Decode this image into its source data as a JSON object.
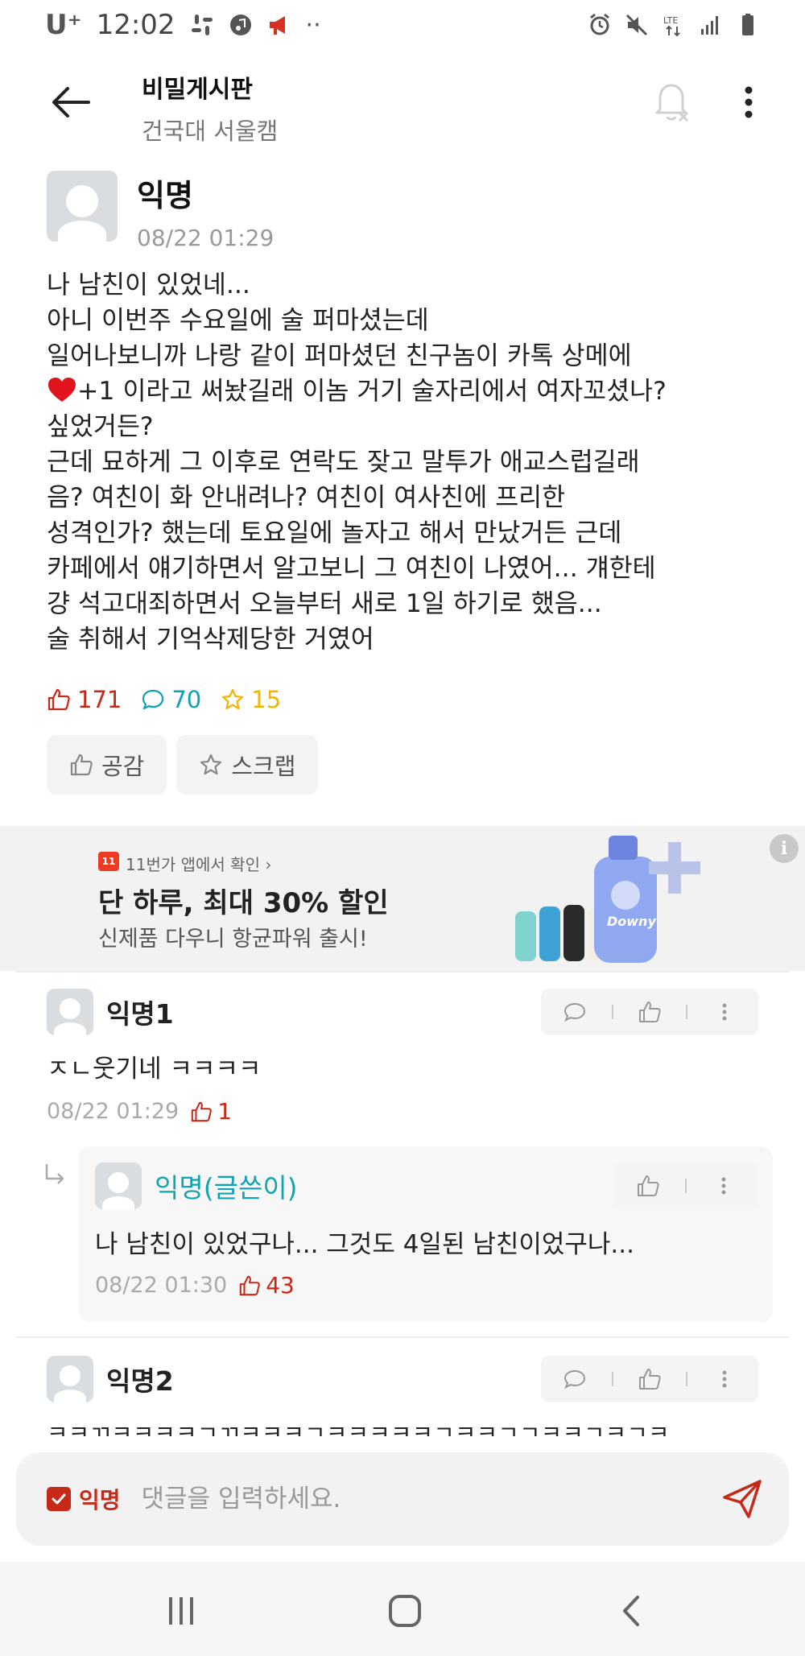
{
  "status_bar": {
    "carrier": "U⁺",
    "time": "12:02"
  },
  "header": {
    "board_title": "비밀게시판",
    "campus": "건국대 서울캠",
    "icons": [
      "back-arrow-icon",
      "notification-off-icon",
      "more-vert-icon"
    ]
  },
  "post": {
    "author": "익명",
    "date": "08/22 01:29",
    "lines": [
      "나 남친이 있었네...",
      "아니 이번주 수요일에 술 퍼마셨는데",
      "일어나보니까 나랑 같이 퍼마셨던 친구놈이 카톡 상메에",
      "+1 이라고 써놨길래 이놈 거기 술자리에서 여자꼬셨나?",
      "싶었거든?",
      "근데 묘하게 그 이후로 연락도 잦고 말투가 애교스럽길래",
      "음? 여친이 화 안내려나? 여친이 여사친에 프리한",
      "성격인가? 했는데 토요일에 놀자고 해서 만났거든 근데",
      "카페에서 얘기하면서 알고보니 그 여친이 나였어... 걔한테",
      "걍 석고대죄하면서 오늘부터 새로 1일 하기로 했음...",
      "술 취해서 기억삭제당한 거였어"
    ],
    "likes": "171",
    "comments": "70",
    "scraps": "15",
    "like_button": "공감",
    "scrap_button": "스크랩"
  },
  "ad": {
    "source": "11번가 앱에서 확인 ›",
    "logo_text": "11",
    "headline": "단 하루, 최대 30% 할인",
    "subtext": "신제품 다우니 항균파워 출시!",
    "info": "i",
    "brand": "Downy"
  },
  "comments": [
    {
      "author": "익명1",
      "text": "ㅈㄴ웃기네 ㅋㅋㅋㅋ",
      "date": "08/22 01:29",
      "likes": "1"
    },
    {
      "author": "익명2",
      "text": "ㅋㅋㄲㅋㅋㅋㅋㄱㄲㅋㅋㅋㄱㅋㅋㅋㅋㅋㄱㅋㅋㄱㄱㅋㅋㄱㅋㄱㅋ"
    }
  ],
  "reply": {
    "author": "익명(글쓴이)",
    "text": "나 남친이 있었구나... 그것도 4일된 남친이었구나...",
    "date": "08/22 01:30",
    "likes": "43"
  },
  "input_bar": {
    "anonymous_label": "익명",
    "anonymous_checked": true,
    "placeholder": "댓글을 입력하세요."
  },
  "colors": {
    "accent_red": "#c62917",
    "comment_teal": "#0ea1b7",
    "scrap_yellow": "#f3b400",
    "op_teal": "#12a3b0"
  }
}
